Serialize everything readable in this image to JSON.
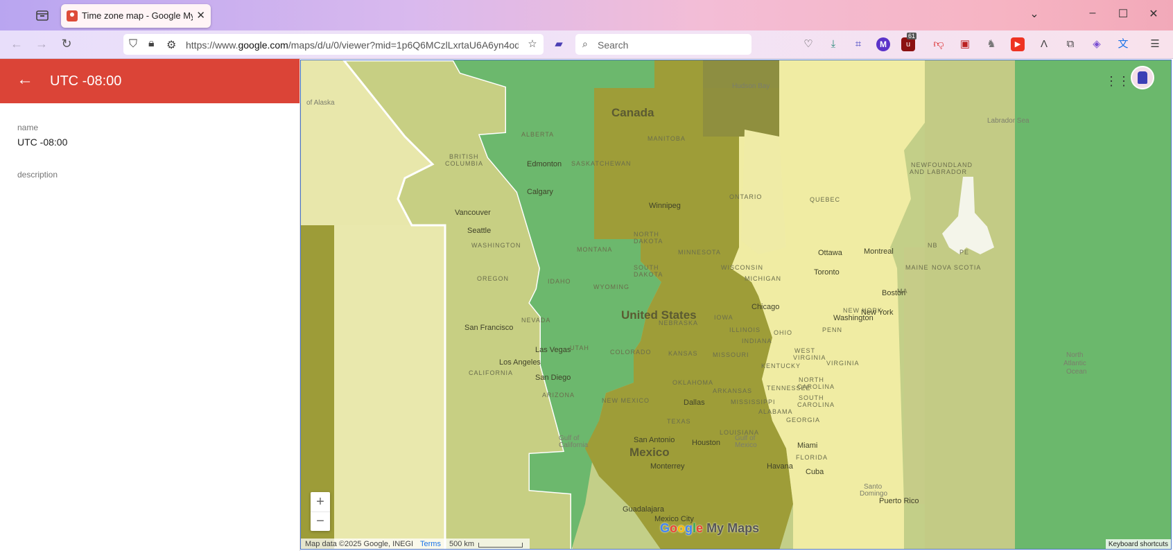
{
  "browser": {
    "tab_title": "Time zone map - Google My M",
    "url_prefix": "https://www.",
    "url_domain": "google.com",
    "url_rest": "/maps/d/u/0/viewer?mid=1p6Q6MCzlLxrtaU6A6yn4od",
    "search_placeholder": "Search",
    "ublock_count": "61"
  },
  "panel": {
    "title": "UTC -08:00",
    "name_label": "name",
    "name_value": "UTC -08:00",
    "description_label": "description"
  },
  "map": {
    "zoom_in": "+",
    "zoom_out": "−",
    "attribution": "Map data ©2025 Google, INEGI",
    "terms": "Terms",
    "scale": "500 km",
    "keyboard_shortcuts": "Keyboard shortcuts",
    "logo_google": [
      "G",
      "o",
      "o",
      "g",
      "l",
      "e"
    ],
    "logo_suffix": "My Maps",
    "labels": {
      "alaska": "of Alaska",
      "canada": "Canada",
      "hudson_bay": "Hudson Bay",
      "labrador_sea": "Labrador Sea",
      "british_columbia_1": "BRITISH",
      "british_columbia_2": "COLUMBIA",
      "alberta": "ALBERTA",
      "saskatchewan": "SASKATCHEWAN",
      "manitoba": "MANITOBA",
      "ontario": "ONTARIO",
      "quebec": "QUEBEC",
      "newfoundland_1": "NEWFOUNDLAND",
      "newfoundland_2": "AND LABRADOR",
      "edmonton": "Edmonton",
      "calgary": "Calgary",
      "winnipeg": "Winnipeg",
      "vancouver": "Vancouver",
      "seattle": "Seattle",
      "washington": "WASHINGTON",
      "oregon": "OREGON",
      "idaho": "IDAHO",
      "montana": "MONTANA",
      "wyoming": "WYOMING",
      "north_dakota_1": "NORTH",
      "north_dakota_2": "DAKOTA",
      "south_dakota_1": "SOUTH",
      "south_dakota_2": "DAKOTA",
      "minnesota": "MINNESOTA",
      "wisconsin": "WISCONSIN",
      "michigan": "MICHIGAN",
      "nevada": "NEVADA",
      "utah": "UTAH",
      "colorado": "COLORADO",
      "nebraska": "NEBRASKA",
      "iowa": "IOWA",
      "illinois": "ILLINOIS",
      "kansas": "KANSAS",
      "missouri": "MISSOURI",
      "california": "CALIFORNIA",
      "arizona": "ARIZONA",
      "new_mexico": "NEW MEXICO",
      "oklahoma": "OKLAHOMA",
      "arkansas": "ARKANSAS",
      "mississippi": "MISSISSIPPI",
      "alabama": "ALABAMA",
      "texas": "TEXAS",
      "louisiana": "LOUISIANA",
      "tennessee": "TENNESSEE",
      "kentucky": "KENTUCKY",
      "ohio": "OHIO",
      "indiana": "INDIANA",
      "west_virginia_1": "WEST",
      "west_virginia_2": "VIRGINIA",
      "virginia": "VIRGINIA",
      "north_carolina_1": "NORTH",
      "north_carolina_2": "CAROLINA",
      "south_carolina_1": "SOUTH",
      "south_carolina_2": "CAROLINA",
      "georgia": "GEORGIA",
      "florida": "FLORIDA",
      "penn": "PENN",
      "new_york_state": "NEW YORK",
      "maine": "MAINE",
      "nb": "NB",
      "pe": "PE",
      "nova_scotia": "NOVA SCOTIA",
      "ma": "MA",
      "united_states": "United States",
      "mexico": "Mexico",
      "san_francisco": "San Francisco",
      "las_vegas": "Las Vegas",
      "los_angeles": "Los Angeles",
      "san_diego": "San Diego",
      "dallas": "Dallas",
      "san_antonio": "San Antonio",
      "houston": "Houston",
      "monterrey": "Monterrey",
      "guadalajara": "Guadalajara",
      "mexico_city": "Mexico City",
      "chicago": "Chicago",
      "toronto": "Toronto",
      "ottawa": "Ottawa",
      "montreal": "Montreal",
      "boston": "Boston",
      "new_york": "New York",
      "washington_dc": "Washington",
      "miami": "Miami",
      "havana": "Havana",
      "cuba": "Cuba",
      "gulf_1": "Gulf of",
      "gulf_2": "Mexico",
      "santo_domingo_1": "Santo",
      "santo_domingo_2": "Domingo",
      "puerto_rico": "Puerto Rico",
      "north_atlantic_1": "North",
      "north_atlantic_2": "Atlantic",
      "north_atlantic_3": "Ocean",
      "gulf_california_1": "Gulf of",
      "gulf_california_2": "California"
    }
  },
  "colors": {
    "zone_pale": "#e8e6a9",
    "zone_olive": "#c4cc86",
    "zone_green": "#6cb96c",
    "zone_dark_olive": "#9c9c37",
    "zone_yellow": "#f0ec9e",
    "panel_header": "#db4437"
  }
}
